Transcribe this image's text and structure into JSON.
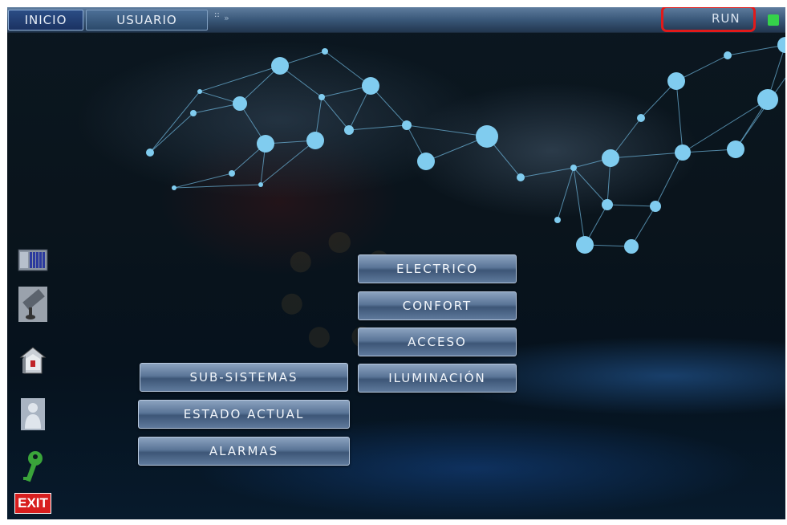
{
  "topbar": {
    "inicio_label": "INICIO",
    "usuario_label": "USUARIO",
    "usuario_dots": "::",
    "usuario_arrow": "»",
    "run_label": "RUN",
    "run_led_color": "#35d24a",
    "highlight_color": "#e11a1a"
  },
  "menu": {
    "sub_sistemas": "SUB-SISTEMAS",
    "estado_actual": "ESTADO ACTUAL",
    "alarmas": "ALARMAS"
  },
  "submenu": {
    "electrico": "ELECTRICO",
    "confort": "CONFORT",
    "acceso": "ACCESO",
    "iluminacion": "ILUMINACIÓN"
  },
  "sidebar": {
    "icons": [
      "plc-rack-icon",
      "security-camera-icon",
      "home-security-icon",
      "user-icon",
      "key-icon",
      "exit-icon"
    ],
    "exit_label": "EXIT"
  },
  "colors": {
    "background": "#0a141c",
    "network": "#7fd0f5"
  }
}
